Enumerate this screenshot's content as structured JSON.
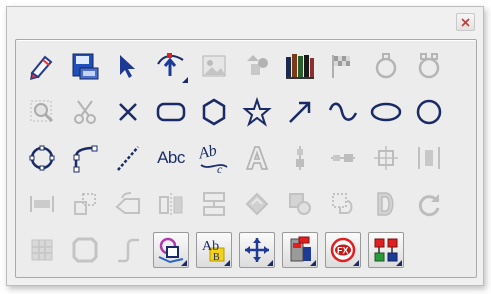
{
  "window": {
    "close_glyph": "✕"
  },
  "tools": {
    "text_abc": "Abc",
    "text_ab": "Ab",
    "text_c": "c"
  },
  "icons": [
    "pencil-icon",
    "save-icon",
    "select-arrow-icon",
    "insert-point-icon",
    "image-icon",
    "shapes-icon",
    "library-icon",
    "flags-icon",
    "ring-icon",
    "double-ring-icon",
    "zoom-icon",
    "scissors-icon",
    "cross-icon",
    "rounded-rect-icon",
    "hexagon-icon",
    "star-icon",
    "arrow-line-icon",
    "curve-icon",
    "ellipse-icon",
    "circle-icon",
    "circle-points-icon",
    "polyline-icon",
    "dashed-line-icon",
    "text-icon",
    "curved-text-icon",
    "outline-text-icon",
    "align-vertical-icon",
    "align-horizontal-icon",
    "align-center-icon",
    "distribute-icon",
    "stretch-icon",
    "group-icon",
    "rotate-icon",
    "flip-icon",
    "order-icon",
    "transform-icon",
    "merge-icon",
    "exclude-icon",
    "letter-d-icon",
    "refresh-icon",
    "grid-icon",
    "frame-icon",
    "bend-icon",
    "shape-layers-icon",
    "text-style-icon",
    "move-icon",
    "fill-icon",
    "effects-icon",
    "arrange-icon"
  ],
  "colors": {
    "accent": "#1c2f6b",
    "disabled": "#b8b8b8",
    "red": "#d62020"
  }
}
